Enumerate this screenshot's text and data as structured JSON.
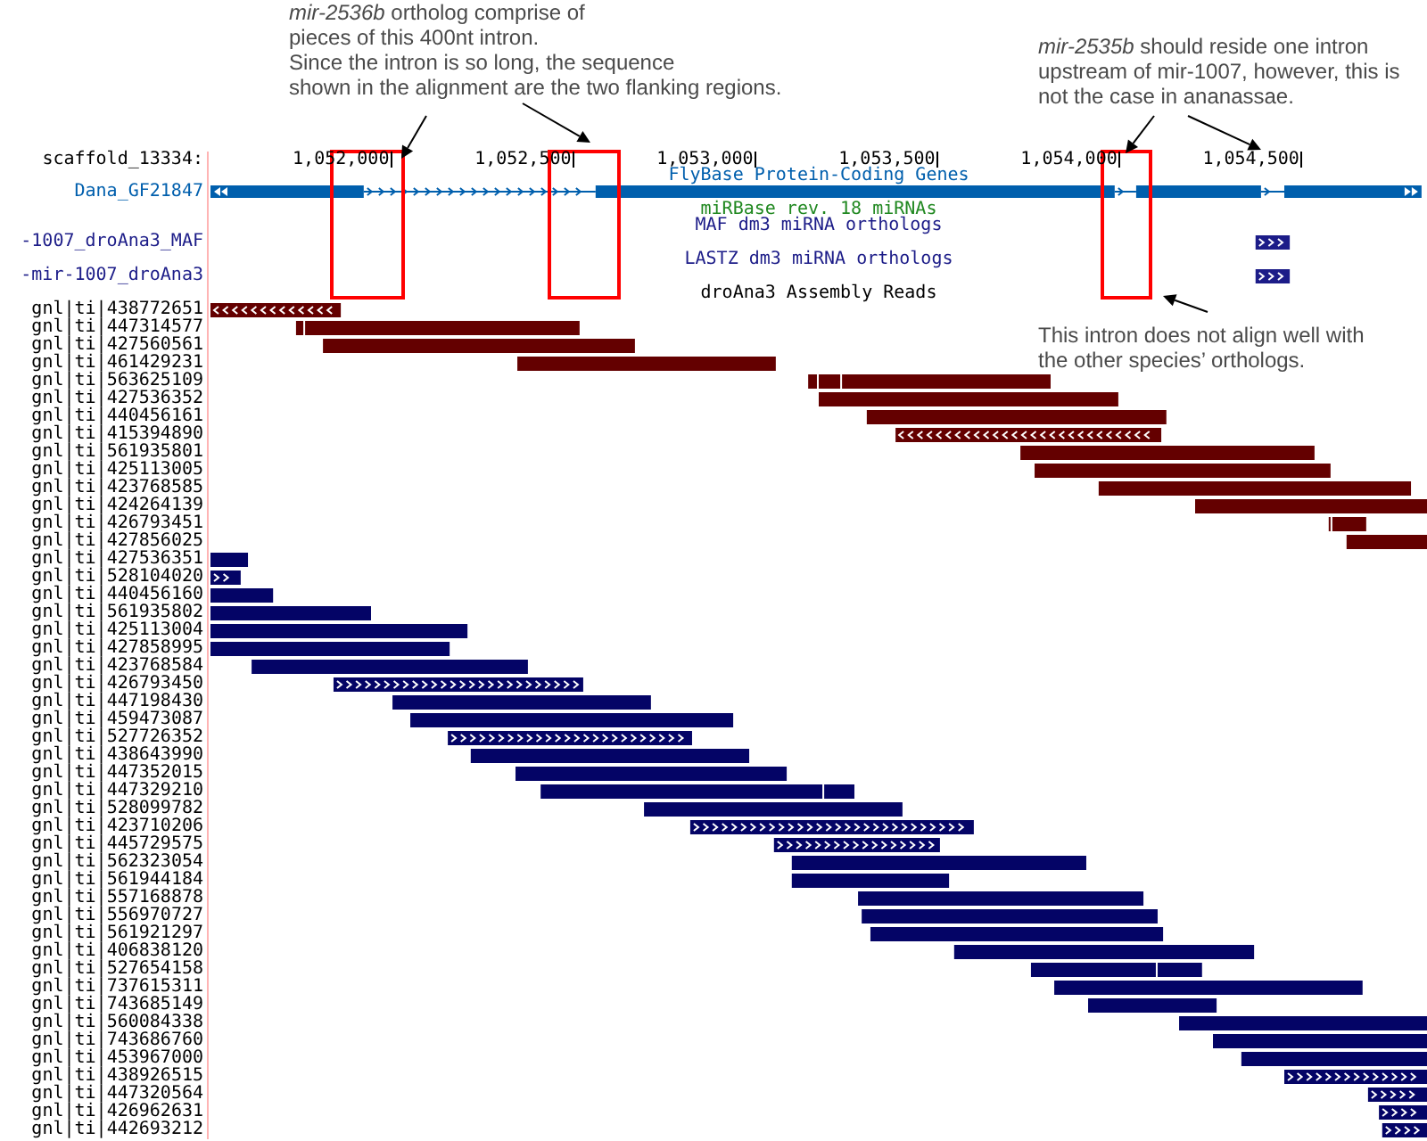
{
  "callouts": [
    {
      "lines": [
        "*mir-2536b* ortholog comprise of",
        "pieces of this 400nt intron.",
        "Since the intron is so long, the sequence",
        "shown in the alignment are the two flanking regions."
      ]
    },
    {
      "lines": [
        "*mir-2535b* should reside one intron",
        "upstream of mir-1007, however, this is",
        "not the case in ananassae."
      ]
    },
    {
      "lines": [
        "This intron does not align well with",
        "the other species’ orthologs."
      ]
    }
  ],
  "browser": {
    "position_label": "scaffold_13334:",
    "ruler": [
      "1,052,000",
      "1,052,500",
      "1,053,000",
      "1,053,500",
      "1,054,000",
      "1,054,500"
    ],
    "tracks": [
      {
        "title": "FlyBase Protein-Coding Genes",
        "color": "#005fad",
        "kind": "gene",
        "items": [
          {
            "label": "Dana_GF21847",
            "chevrons_left": false,
            "chevrons_right": true,
            "continues_left": true,
            "continues_right": true
          }
        ]
      },
      {
        "title": "miRBase rev. 18 miRNAs",
        "color": "#208820",
        "kind": "mirna"
      },
      {
        "title": "MAF dm3 miRNA orthologs",
        "color": "#1c1c88",
        "kind": "ortholog",
        "items": [
          {
            "label": "-1007_droAna3_MAF",
            "chevrons_left": false,
            "chevrons_right": true
          }
        ]
      },
      {
        "title": "LASTZ dm3 miRNA orthologs",
        "color": "#1c1c88",
        "kind": "ortholog",
        "items": [
          {
            "label": "-mir-1007_droAna3",
            "chevrons_left": false,
            "chevrons_right": true
          }
        ]
      },
      {
        "title": "droAna3 Assembly Reads",
        "color": "#000000",
        "kind": "read",
        "items": [
          {
            "label": "gnl|ti|438772651",
            "color": "#640000",
            "chevrons_left": true,
            "chevrons_right": false
          },
          {
            "label": "gnl|ti|447314577",
            "color": "#640000",
            "chevrons_left": false,
            "chevrons_right": false
          },
          {
            "label": "gnl|ti|427560561",
            "color": "#640000",
            "chevrons_left": false,
            "chevrons_right": false
          },
          {
            "label": "gnl|ti|461429231",
            "color": "#640000",
            "chevrons_left": false,
            "chevrons_right": false
          },
          {
            "label": "gnl|ti|563625109",
            "color": "#640000",
            "chevrons_left": false,
            "chevrons_right": false
          },
          {
            "label": "gnl|ti|427536352",
            "color": "#640000",
            "chevrons_left": false,
            "chevrons_right": false
          },
          {
            "label": "gnl|ti|440456161",
            "color": "#640000",
            "chevrons_left": false,
            "chevrons_right": false
          },
          {
            "label": "gnl|ti|415394890",
            "color": "#640000",
            "chevrons_left": true,
            "chevrons_right": false
          },
          {
            "label": "gnl|ti|561935801",
            "color": "#640000",
            "chevrons_left": false,
            "chevrons_right": false
          },
          {
            "label": "gnl|ti|425113005",
            "color": "#640000",
            "chevrons_left": false,
            "chevrons_right": false
          },
          {
            "label": "gnl|ti|423768585",
            "color": "#640000",
            "chevrons_left": false,
            "chevrons_right": false
          },
          {
            "label": "gnl|ti|424264139",
            "color": "#640000",
            "chevrons_left": false,
            "chevrons_right": false
          },
          {
            "label": "gnl|ti|426793451",
            "color": "#640000",
            "chevrons_left": false,
            "chevrons_right": false
          },
          {
            "label": "gnl|ti|427856025",
            "color": "#640000",
            "chevrons_left": false,
            "chevrons_right": false
          },
          {
            "label": "gnl|ti|427536351",
            "color": "#040466",
            "chevrons_left": false,
            "chevrons_right": false
          },
          {
            "label": "gnl|ti|528104020",
            "color": "#040466",
            "chevrons_left": false,
            "chevrons_right": true
          },
          {
            "label": "gnl|ti|440456160",
            "color": "#040466",
            "chevrons_left": false,
            "chevrons_right": false
          },
          {
            "label": "gnl|ti|561935802",
            "color": "#040466",
            "chevrons_left": false,
            "chevrons_right": false
          },
          {
            "label": "gnl|ti|425113004",
            "color": "#040466",
            "chevrons_left": false,
            "chevrons_right": false
          },
          {
            "label": "gnl|ti|427858995",
            "color": "#040466",
            "chevrons_left": false,
            "chevrons_right": false
          },
          {
            "label": "gnl|ti|423768584",
            "color": "#040466",
            "chevrons_left": false,
            "chevrons_right": false
          },
          {
            "label": "gnl|ti|426793450",
            "color": "#040466",
            "chevrons_left": false,
            "chevrons_right": true
          },
          {
            "label": "gnl|ti|447198430",
            "color": "#040466",
            "chevrons_left": false,
            "chevrons_right": false
          },
          {
            "label": "gnl|ti|459473087",
            "color": "#040466",
            "chevrons_left": false,
            "chevrons_right": false
          },
          {
            "label": "gnl|ti|527726352",
            "color": "#040466",
            "chevrons_left": false,
            "chevrons_right": true
          },
          {
            "label": "gnl|ti|438643990",
            "color": "#040466",
            "chevrons_left": false,
            "chevrons_right": false
          },
          {
            "label": "gnl|ti|447352015",
            "color": "#040466",
            "chevrons_left": false,
            "chevrons_right": false
          },
          {
            "label": "gnl|ti|447329210",
            "color": "#040466",
            "chevrons_left": false,
            "chevrons_right": false
          },
          {
            "label": "gnl|ti|528099782",
            "color": "#040466",
            "chevrons_left": false,
            "chevrons_right": false
          },
          {
            "label": "gnl|ti|423710206",
            "color": "#040466",
            "chevrons_left": false,
            "chevrons_right": true
          },
          {
            "label": "gnl|ti|445729575",
            "color": "#040466",
            "chevrons_left": false,
            "chevrons_right": true
          },
          {
            "label": "gnl|ti|562323054",
            "color": "#040466",
            "chevrons_left": false,
            "chevrons_right": false
          },
          {
            "label": "gnl|ti|561944184",
            "color": "#040466",
            "chevrons_left": false,
            "chevrons_right": false
          },
          {
            "label": "gnl|ti|557168878",
            "color": "#040466",
            "chevrons_left": false,
            "chevrons_right": false
          },
          {
            "label": "gnl|ti|556970727",
            "color": "#040466",
            "chevrons_left": false,
            "chevrons_right": false
          },
          {
            "label": "gnl|ti|561921297",
            "color": "#040466",
            "chevrons_left": false,
            "chevrons_right": false
          },
          {
            "label": "gnl|ti|406838120",
            "color": "#040466",
            "chevrons_left": false,
            "chevrons_right": false
          },
          {
            "label": "gnl|ti|527654158",
            "color": "#040466",
            "chevrons_left": false,
            "chevrons_right": false
          },
          {
            "label": "gnl|ti|737615311",
            "color": "#040466",
            "chevrons_left": false,
            "chevrons_right": false
          },
          {
            "label": "gnl|ti|743685149",
            "color": "#040466",
            "chevrons_left": false,
            "chevrons_right": false
          },
          {
            "label": "gnl|ti|560084338",
            "color": "#040466",
            "chevrons_left": false,
            "chevrons_right": false
          },
          {
            "label": "gnl|ti|743686760",
            "color": "#040466",
            "chevrons_left": false,
            "chevrons_right": false
          },
          {
            "label": "gnl|ti|453967000",
            "color": "#040466",
            "chevrons_left": false,
            "chevrons_right": false
          },
          {
            "label": "gnl|ti|438926515",
            "color": "#040466",
            "chevrons_left": false,
            "chevrons_right": true
          },
          {
            "label": "gnl|ti|447320564",
            "color": "#040466",
            "chevrons_left": false,
            "chevrons_right": true
          },
          {
            "label": "gnl|ti|426962631",
            "color": "#040466",
            "chevrons_left": false,
            "chevrons_right": true
          },
          {
            "label": "gnl|ti|442693212",
            "color": "#040466",
            "chevrons_left": false,
            "chevrons_right": true
          }
        ]
      }
    ]
  }
}
